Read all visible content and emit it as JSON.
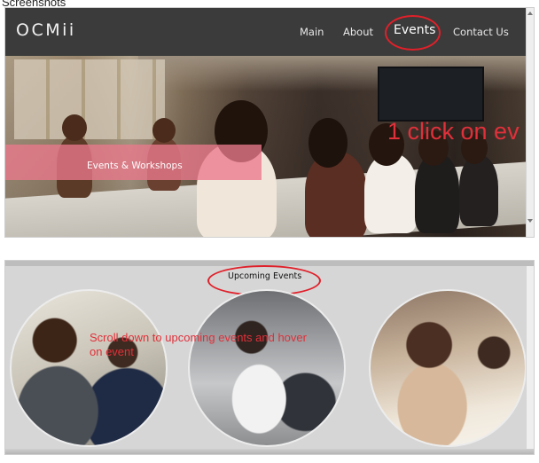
{
  "caption": "Screenshots",
  "screenshot1": {
    "logo": "OCMii",
    "nav": {
      "main": "Main",
      "about": "About",
      "events": "Events",
      "contact": "Contact Us"
    },
    "hero_banner_text": "Events & Workshops",
    "annotation": "1 click on ev",
    "colors": {
      "navbar_bg": "#3a3b3a",
      "banner_overlay": "#eb788c",
      "annotation": "#e0303a"
    }
  },
  "screenshot2": {
    "section_title": "Upcoming Events",
    "annotation": "Scroll down to upcoming events and hover on event",
    "events": [
      {
        "name": "event-photo-1"
      },
      {
        "name": "event-photo-2"
      },
      {
        "name": "event-photo-3"
      }
    ],
    "colors": {
      "section_bg": "#d6d6d6",
      "annotation": "#e0303a"
    }
  }
}
